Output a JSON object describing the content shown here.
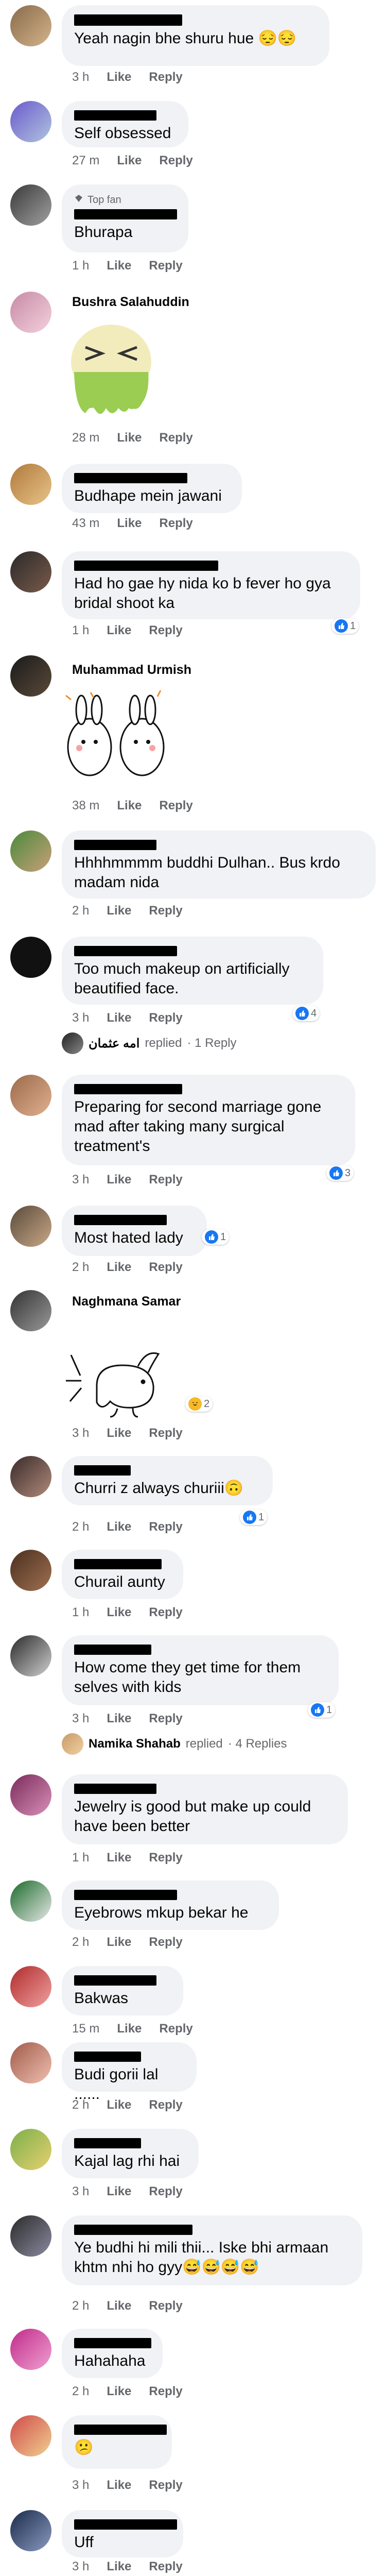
{
  "labels": {
    "like": "Like",
    "reply": "Reply"
  },
  "colors": {
    "bubble": "#f0f2f5",
    "meta": "#65676b",
    "reaction_blue": "#1877f2"
  },
  "comments": [
    {
      "name": "",
      "text": "Yeah nagin bhe shuru hue 😔😔",
      "time": "3 h"
    },
    {
      "name": "",
      "text": "Self obsessed",
      "time": "27 m"
    },
    {
      "badge": "Top fan",
      "name": "",
      "text": "Bhurapa",
      "time": "1 h"
    },
    {
      "name": "Bushra Salahuddin",
      "sticker": "sick-face-sticker",
      "time": "28 m"
    },
    {
      "name": "",
      "text": "Budhape mein jawani",
      "time": "43 m"
    },
    {
      "name": "",
      "text": "Had ho gae hy nida ko b fever ho gya bridal shoot ka",
      "time": "1 h",
      "reactions": "1"
    },
    {
      "name": "Muhammad Urmish",
      "sticker": "rabbits-sticker",
      "time": "38 m"
    },
    {
      "name": "",
      "text": "Hhhhmmmm buddhi Dulhan.. Bus krdo madam nida",
      "time": "2 h"
    },
    {
      "name": "",
      "text": "Too much makeup on artificially beautified face.",
      "time": "3 h",
      "reactions": "4",
      "reply_summary": {
        "name": "امه عثمان",
        "action": "replied",
        "count": "· 1 Reply"
      }
    },
    {
      "name": "",
      "text": "Preparing for second marriage gone mad after taking many surgical treatment's",
      "time": "3 h",
      "reactions": "3"
    },
    {
      "name": "",
      "text": "Most hated lady",
      "time": "2 h",
      "reactions": "1"
    },
    {
      "name": "Naghmana Samar",
      "sticker": "bunny-sticker",
      "time": "3 h",
      "reactions": "2"
    },
    {
      "name": "",
      "text": "Churri z always churiii🙃",
      "time": "2 h",
      "reactions": "1"
    },
    {
      "name": "",
      "text": "Churail aunty",
      "time": "1 h"
    },
    {
      "name": "",
      "text": "How come they get time for them selves with kids",
      "time": "3 h",
      "reactions": "1",
      "reply_summary": {
        "name": "Namika Shahab",
        "action": "replied",
        "count": "· 4 Replies"
      }
    },
    {
      "name": "",
      "text": "Jewelry is good but make up could have been better",
      "time": "1 h"
    },
    {
      "name": "",
      "text": "Eyebrows mkup bekar he",
      "time": "2 h"
    },
    {
      "name": "",
      "text": "Bakwas",
      "time": "15 m"
    },
    {
      "name": "",
      "text": "Budi gorii lal ......",
      "time": "2 h"
    },
    {
      "name": "",
      "text": "Kajal lag rhi hai",
      "time": "3 h"
    },
    {
      "name": "",
      "text": "Ye budhi hi mili thii... Iske bhi armaan khtm nhi ho gyy😅😅😅😅",
      "time": "2 h"
    },
    {
      "name": "",
      "text": "Hahahaha",
      "time": "2 h"
    },
    {
      "name": "",
      "text": "😕",
      "time": "3 h"
    },
    {
      "name": "",
      "text": "Uff",
      "time": "3 h"
    }
  ]
}
